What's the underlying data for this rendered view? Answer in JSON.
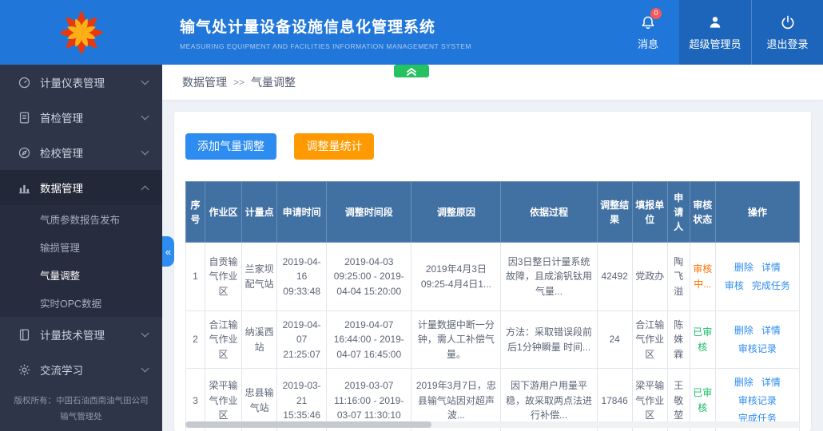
{
  "colors": {
    "header_blue": "#2176d9",
    "sidebar_dark": "#2e3548",
    "table_header_blue": "#4170a3",
    "primary_blue": "#2d8cf0",
    "button_orange": "#ff9900",
    "pending_orange": "#ff6f00",
    "success_green": "#19be6b",
    "collapse_green": "#26c161",
    "badge_red": "#f25a5a"
  },
  "header": {
    "title": "输气处计量设备设施信息化管理系统",
    "subtitle": "MEASURING EQUIPMENT AND FACILITIES INFORMATION MANAGEMENT SYSTEM",
    "logo_icon": "petrochina-logo",
    "messages": {
      "label": "消息",
      "badge": "0",
      "icon": "bell-icon"
    },
    "admin": {
      "label": "超级管理员",
      "icon": "user-icon"
    },
    "logout": {
      "label": "退出登录",
      "icon": "power-icon"
    }
  },
  "sidebar": {
    "items": [
      {
        "label": "计量仪表管理",
        "icon": "gauge-icon"
      },
      {
        "label": "首检管理",
        "icon": "document-icon"
      },
      {
        "label": "检校管理",
        "icon": "compass-icon"
      },
      {
        "label": "数据管理",
        "icon": "bar-chart-icon"
      },
      {
        "label": "计量技术管理",
        "icon": "book-icon"
      },
      {
        "label": "交流学习",
        "icon": "gear-icon"
      }
    ],
    "submenu": [
      "气质参数报告发布",
      "输损管理",
      "气量调整",
      "实时OPC数据"
    ],
    "copyright1": "版权所有：中国石油西南油气田公司",
    "copyright2": "输气管理处"
  },
  "breadcrumb": {
    "section": "数据管理",
    "separator": ">>",
    "page": "气量调整"
  },
  "toolbar": {
    "add_button": "添加气量调整",
    "stats_button": "调整量统计"
  },
  "table": {
    "headers": [
      "序号",
      "作业区",
      "计量点",
      "申请时间",
      "调整时间段",
      "调整原因",
      "依据过程",
      "调整结果",
      "填报单位",
      "申请人",
      "审核状态",
      "操作"
    ],
    "rows": [
      {
        "seq": "1",
        "area": "自贡输气作业区",
        "point": "兰家坝配气站",
        "apply_time": "2019-04-16 09:33:48",
        "period": "2019-04-03 09:25:00 - 2019-04-04 15:20:00",
        "reason": "2019年4月3日09:25-4月4日1...",
        "basis": "因3日整日计量系统故障，且成渝钒钛用气量...",
        "result": "42492",
        "unit": "党政办",
        "applicant": "陶飞溢",
        "status": "审核中...",
        "status_color": "#ff6f00",
        "actions": [
          "删除",
          "详情",
          "审核",
          "完成任务"
        ]
      },
      {
        "seq": "2",
        "area": "合江输气作业区",
        "point": "纳溪西站",
        "apply_time": "2019-04-07 21:25:07",
        "period": "2019-04-07 16:44:00 - 2019-04-07 16:45:00",
        "reason": "计量数据中断一分钟，需人工补偿气量。",
        "basis": "方法：采取错误段前后1分钟瞬量 时间...",
        "result": "24",
        "unit": "合江输气作业区",
        "applicant": "陈姝霖",
        "status": "已审核",
        "status_color": "#19be6b",
        "actions": [
          "删除",
          "详情",
          "审核记录"
        ]
      },
      {
        "seq": "3",
        "area": "梁平输气作业区",
        "point": "忠县输气站",
        "apply_time": "2019-03-21 15:35:46",
        "period": "2019-03-07 11:16:00 - 2019-03-07 11:30:10",
        "reason": "2019年3月7日，忠县输气站因对超声波...",
        "basis": "因下游用户用量平稳，故采取两点法进行补偿...",
        "result": "17846",
        "unit": "梁平输气作业区",
        "applicant": "王敬堃",
        "status": "已审核",
        "status_color": "#19be6b",
        "actions": [
          "删除",
          "详情",
          "审核记录",
          "完成任务"
        ]
      }
    ]
  }
}
